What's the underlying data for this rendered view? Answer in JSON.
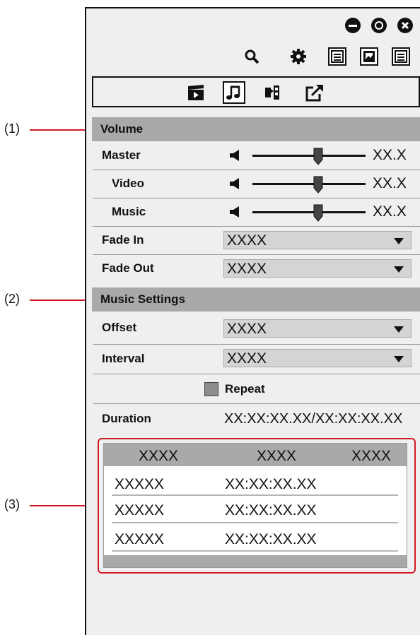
{
  "callouts": [
    "(1)",
    "(2)",
    "(3)"
  ],
  "window_controls": {
    "minimize": "minimize-icon",
    "restore": "restore-icon",
    "close": "close-icon"
  },
  "toolbar": {
    "icons": [
      "search-icon",
      "gear-icon",
      "list-view-icon",
      "image-view-icon",
      "detail-view-icon"
    ]
  },
  "tabs": {
    "icons": [
      "clip-icon",
      "music-icon",
      "effects-icon",
      "export-icon"
    ],
    "active_index": 1
  },
  "volume_section": {
    "title": "Volume",
    "rows": [
      {
        "label": "Master",
        "value": "XX.X",
        "level": 0.58
      },
      {
        "label": "Video",
        "value": "XX.X",
        "level": 0.58
      },
      {
        "label": "Music",
        "value": "XX.X",
        "level": 0.58
      }
    ],
    "fade_in": {
      "label": "Fade In",
      "value": "XXXX"
    },
    "fade_out": {
      "label": "Fade Out",
      "value": "XXXX"
    }
  },
  "music_section": {
    "title": "Music Settings",
    "offset": {
      "label": "Offset",
      "value": "XXXX"
    },
    "interval": {
      "label": "Interval",
      "value": "XXXX"
    },
    "repeat": {
      "label": "Repeat",
      "checked": false
    },
    "duration": {
      "label": "Duration",
      "value": "XX:XX:XX.XX/XX:XX:XX.XX"
    }
  },
  "table": {
    "headers": [
      "XXXX",
      "XXXX",
      "XXXX"
    ],
    "rows": [
      [
        "XXXXX",
        "XX:XX:XX.XX"
      ],
      [
        "XXXXX",
        "XX:XX:XX.XX"
      ],
      [
        "XXXXX",
        "XX:XX:XX.XX"
      ]
    ]
  },
  "colors": {
    "callout_red": "#d21a24",
    "section_gray": "#a9a9a9",
    "panel_bg": "#efefef"
  }
}
